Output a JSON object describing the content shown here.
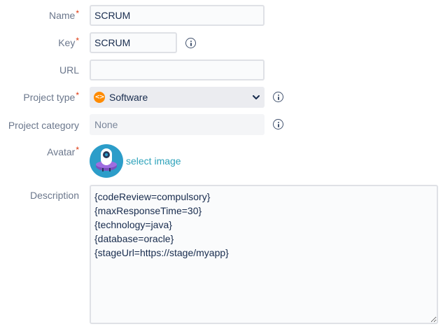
{
  "form": {
    "name": {
      "label": "Name",
      "required_mark": "*",
      "value": "SCRUM"
    },
    "key": {
      "label": "Key",
      "required_mark": "*",
      "value": "SCRUM"
    },
    "url": {
      "label": "URL",
      "value": ""
    },
    "project_type": {
      "label": "Project type",
      "required_mark": "*",
      "value": "Software",
      "icon": "code-brackets-icon",
      "icon_color": "#ff8b00"
    },
    "project_category": {
      "label": "Project category",
      "value": "None"
    },
    "avatar": {
      "label": "Avatar",
      "required_mark": "*",
      "link_text": "select image"
    },
    "description": {
      "label": "Description",
      "value": "{codeReview=compulsory}\n{maxResponseTime=30}\n{technology=java}\n{database=oracle}\n{stageUrl=https://stage/myapp}"
    }
  },
  "colors": {
    "link": "#2fa3bb",
    "required": "#de350b",
    "label": "#6b778c",
    "avatar_bg": "#2c9dc9"
  }
}
